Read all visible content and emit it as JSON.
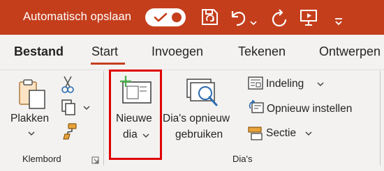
{
  "titlebar": {
    "autosave_label": "Automatisch opslaan",
    "autosave_state": "on"
  },
  "tabs": [
    {
      "label": "Bestand"
    },
    {
      "label": "Start"
    },
    {
      "label": "Invoegen"
    },
    {
      "label": "Tekenen"
    },
    {
      "label": "Ontwerpen"
    }
  ],
  "ribbon": {
    "clipboard": {
      "paste_label": "Plakken",
      "group_label": "Klembord"
    },
    "slides": {
      "new_slide_line1": "Nieuwe",
      "new_slide_line2": "dia",
      "reuse_line1": "Dia's opnieuw",
      "reuse_line2": "gebruiken",
      "layout_label": "Indeling",
      "reset_label": "Opnieuw instellen",
      "section_label": "Sectie",
      "group_label": "Dia's"
    }
  },
  "colors": {
    "accent": "#c43e1c",
    "highlight": "#e00000",
    "plus_green": "#4caf50"
  },
  "icons": {
    "undo": "undo-icon",
    "redo": "redo-icon",
    "save": "save-sync-icon",
    "present": "present-icon",
    "customize": "customize-qat-icon"
  }
}
